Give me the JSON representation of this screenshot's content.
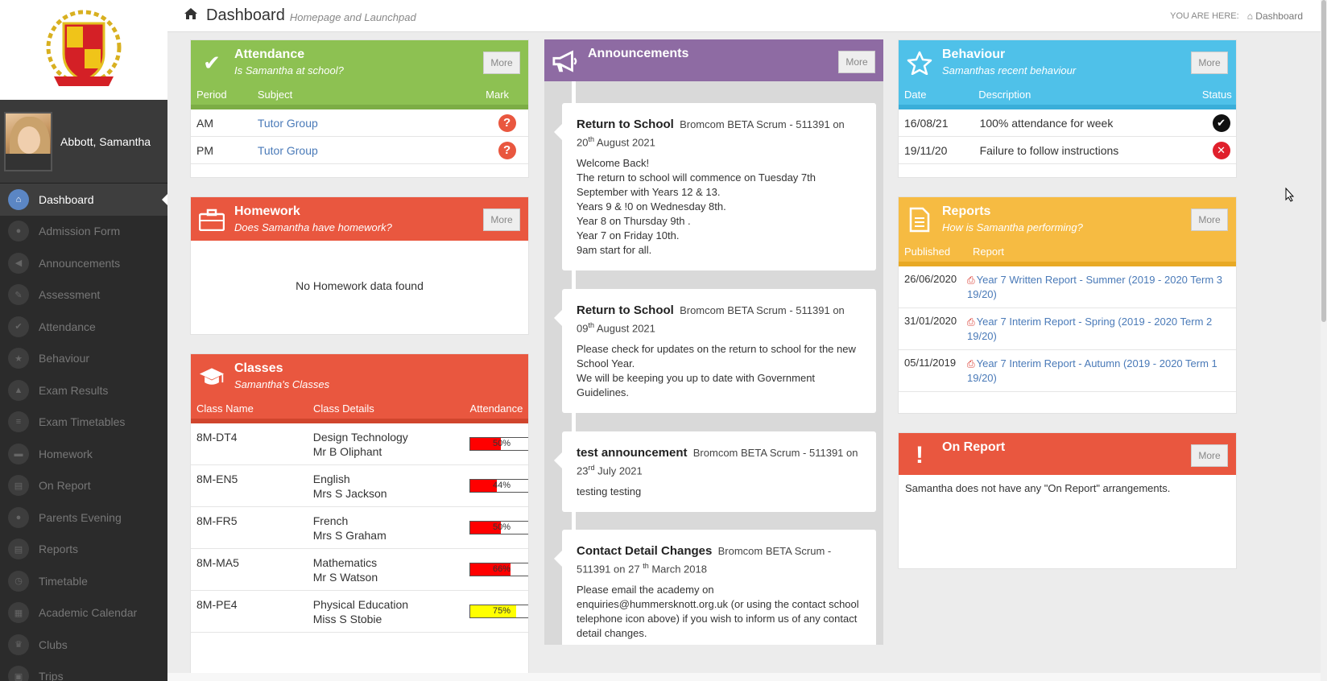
{
  "user": {
    "name": "Abbott, Samantha"
  },
  "nav": [
    {
      "label": "Dashboard",
      "icon": "home-icon",
      "glyph": "⌂",
      "active": true
    },
    {
      "label": "Admission Form",
      "icon": "user-icon",
      "glyph": "●"
    },
    {
      "label": "Announcements",
      "icon": "megaphone-icon",
      "glyph": "◀"
    },
    {
      "label": "Assessment",
      "icon": "pencil-icon",
      "glyph": "✎"
    },
    {
      "label": "Attendance",
      "icon": "check-icon",
      "glyph": "✔"
    },
    {
      "label": "Behaviour",
      "icon": "star-icon",
      "glyph": "★"
    },
    {
      "label": "Exam Results",
      "icon": "graduation-cap-icon",
      "glyph": "▲"
    },
    {
      "label": "Exam Timetables",
      "icon": "list-icon",
      "glyph": "≡"
    },
    {
      "label": "Homework",
      "icon": "briefcase-icon",
      "glyph": "▬"
    },
    {
      "label": "On Report",
      "icon": "file-icon",
      "glyph": "▤"
    },
    {
      "label": "Parents Evening",
      "icon": "users-icon",
      "glyph": "●"
    },
    {
      "label": "Reports",
      "icon": "document-icon",
      "glyph": "▤"
    },
    {
      "label": "Timetable",
      "icon": "clock-icon",
      "glyph": "◷"
    },
    {
      "label": "Academic Calendar",
      "icon": "calendar-icon",
      "glyph": "▦"
    },
    {
      "label": "Clubs",
      "icon": "trophy-icon",
      "glyph": "♛"
    },
    {
      "label": "Trips",
      "icon": "bus-icon",
      "glyph": "▣"
    }
  ],
  "header": {
    "title": "Dashboard",
    "subtitle": "Homepage and Launchpad",
    "you_are_here": "YOU ARE HERE:",
    "crumb": "Dashboard"
  },
  "more_label": "More",
  "attendance": {
    "title": "Attendance",
    "subtitle": "Is Samantha at school?",
    "columns": [
      "Period",
      "Subject",
      "Mark"
    ],
    "rows": [
      {
        "period": "AM",
        "subject": "Tutor Group"
      },
      {
        "period": "PM",
        "subject": "Tutor Group"
      }
    ],
    "mark_glyph": "?"
  },
  "homework": {
    "title": "Homework",
    "subtitle": "Does Samantha have homework?",
    "empty": "No Homework data found"
  },
  "classes": {
    "title": "Classes",
    "subtitle": "Samantha's Classes",
    "columns": [
      "Class Name",
      "Class Details",
      "Attendance"
    ],
    "rows": [
      {
        "name": "8M-DT4",
        "subject": "Design Technology",
        "teacher": "Mr B Oliphant",
        "attendance": "50%",
        "pct": 50,
        "color": "#ff0000"
      },
      {
        "name": "8M-EN5",
        "subject": "English",
        "teacher": "Mrs S Jackson",
        "attendance": "44%",
        "pct": 44,
        "color": "#ff0000"
      },
      {
        "name": "8M-FR5",
        "subject": "French",
        "teacher": "Mrs S Graham",
        "attendance": "50%",
        "pct": 50,
        "color": "#ff0000"
      },
      {
        "name": "8M-MA5",
        "subject": "Mathematics",
        "teacher": "Mr S Watson",
        "attendance": "66%",
        "pct": 66,
        "color": "#ff0000"
      },
      {
        "name": "8M-PE4",
        "subject": "Physical Education",
        "teacher": "Miss S Stobie",
        "attendance": "75%",
        "pct": 75,
        "color": "#ffff00"
      }
    ]
  },
  "announcements": {
    "title": "Announcements",
    "items": [
      {
        "title": "Return to School",
        "meta": "Bromcom BETA Scrum - 511391 on",
        "day": "20",
        "suffix": "th",
        "rest": " August 2021",
        "text": "Welcome Back!\nThe return to school will commence on Tuesday 7th September with Years 12 & 13.\nYears 9 & !0 on Wednesday 8th.\nYear 8 on Thursday 9th .\nYear 7 on Friday 10th.\n9am start for all."
      },
      {
        "title": "Return to School",
        "meta": "Bromcom BETA Scrum - 511391 on",
        "day": "09",
        "suffix": "th",
        "rest": " August 2021",
        "text": "Please check for updates on the return to school for the new School Year.\nWe will be keeping you up to date with Government Guidelines."
      },
      {
        "title": "test announcement",
        "meta": "Bromcom BETA Scrum - 511391 on",
        "day": "23",
        "suffix": "rd",
        "rest": " July 2021",
        "text": "testing testing"
      },
      {
        "title": "Contact Detail Changes",
        "meta": "Bromcom BETA Scrum - 511391 on 27",
        "day": "",
        "suffix": "th",
        "rest": " March 2018",
        "text": "Please email the academy on enquiries@hummersknott.org.uk (or using the contact school telephone icon above) if you wish to inform us of any contact detail changes."
      }
    ]
  },
  "behaviour": {
    "title": "Behaviour",
    "subtitle": "Samanthas recent behaviour",
    "columns": [
      "Date",
      "Description",
      "Status"
    ],
    "rows": [
      {
        "date": "16/08/21",
        "description": "100% attendance for week",
        "status": "positive"
      },
      {
        "date": "19/11/20",
        "description": "Failure to follow instructions",
        "status": "negative"
      }
    ]
  },
  "reports": {
    "title": "Reports",
    "subtitle": "How is Samantha performing?",
    "columns": [
      "Published",
      "Report"
    ],
    "rows": [
      {
        "published": "26/06/2020",
        "report": "Year 7 Written Report - Summer (2019 - 2020 Term 3 19/20)"
      },
      {
        "published": "31/01/2020",
        "report": "Year 7 Interim Report - Spring (2019 - 2020 Term 2 19/20)"
      },
      {
        "published": "05/11/2019",
        "report": "Year 7 Interim Report - Autumn (2019 - 2020 Term 1 19/20)"
      }
    ]
  },
  "on_report": {
    "title": "On Report",
    "text": "Samantha does not have any \"On Report\" arrangements."
  },
  "colors": {
    "attendance_header": "#8dc152",
    "homework_header": "#e9573f",
    "classes_header": "#e9573f",
    "announcements_header": "#8e6ba3",
    "behaviour_header": "#4fc1e9",
    "reports_header": "#f6bb42",
    "on_report_header": "#e9573f"
  }
}
